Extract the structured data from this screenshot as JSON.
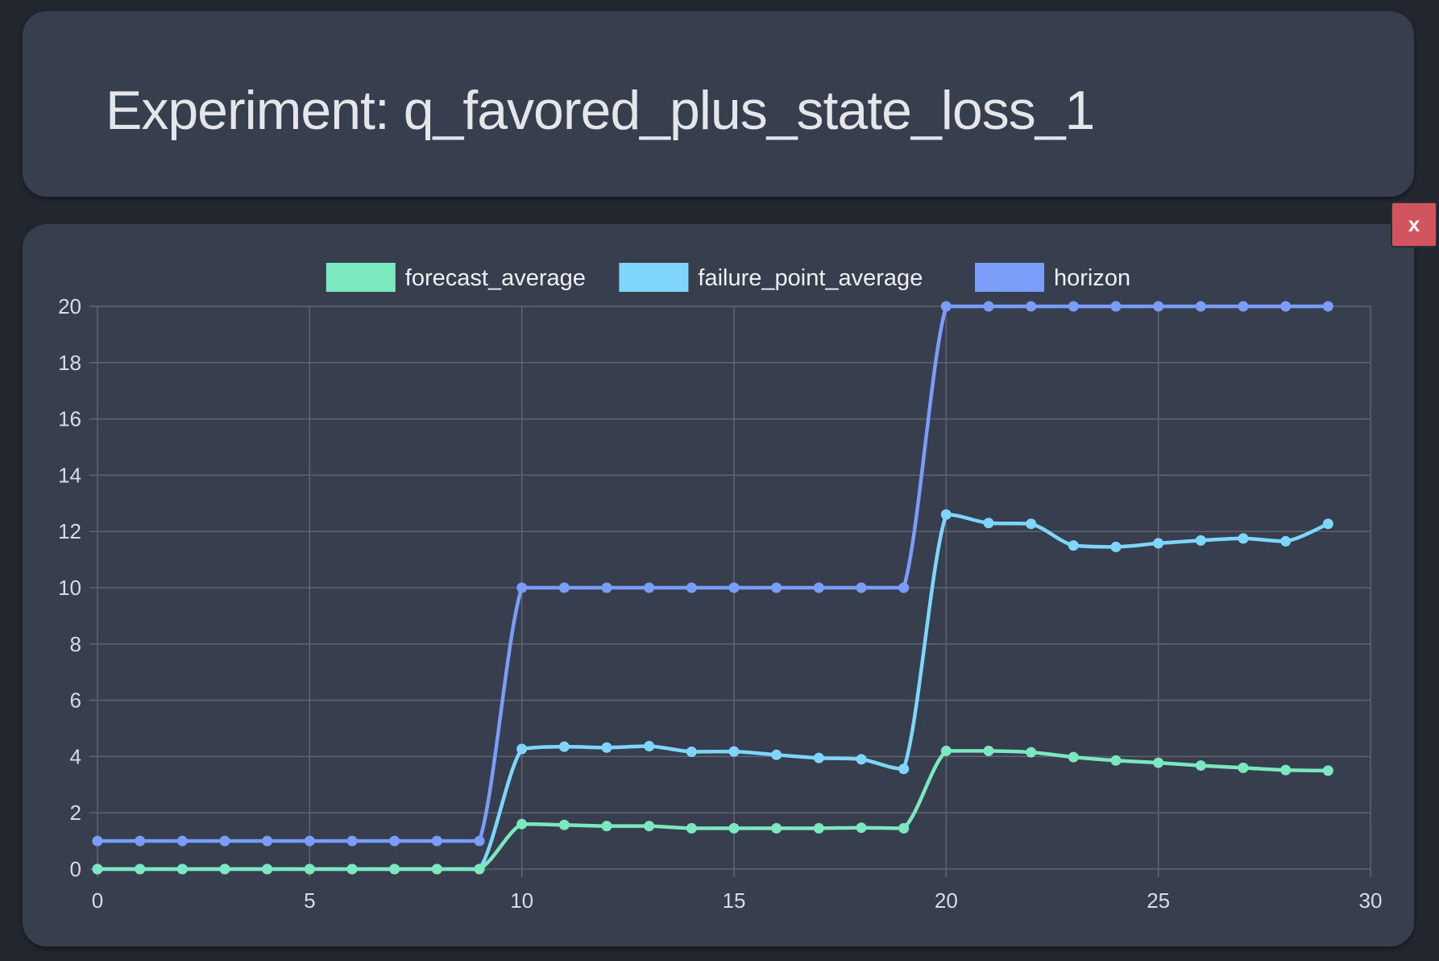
{
  "header": {
    "title": "Experiment: q_favored_plus_state_loss_1"
  },
  "close_button": {
    "label": "x"
  },
  "chart_data": {
    "type": "line",
    "legend_position": "top",
    "grid": true,
    "xlim": [
      0,
      30
    ],
    "ylim": [
      0,
      20
    ],
    "x_ticks": [
      0,
      5,
      10,
      15,
      20,
      25,
      30
    ],
    "y_ticks": [
      0,
      2,
      4,
      6,
      8,
      10,
      12,
      14,
      16,
      18,
      20
    ],
    "x": [
      0,
      1,
      2,
      3,
      4,
      5,
      6,
      7,
      8,
      9,
      10,
      11,
      12,
      13,
      14,
      15,
      16,
      17,
      18,
      19,
      20,
      21,
      22,
      23,
      24,
      25,
      26,
      27,
      28,
      29
    ],
    "series": [
      {
        "name": "forecast_average",
        "color": "#7ce8c0",
        "values": [
          0,
          0,
          0,
          0,
          0,
          0,
          0,
          0,
          0,
          0,
          1.6,
          1.57,
          1.53,
          1.53,
          1.45,
          1.45,
          1.45,
          1.45,
          1.47,
          1.45,
          4.2,
          4.2,
          4.15,
          3.98,
          3.86,
          3.78,
          3.68,
          3.6,
          3.52,
          3.5
        ]
      },
      {
        "name": "failure_point_average",
        "color": "#7fd6fd",
        "values": [
          0,
          0,
          0,
          0,
          0,
          0,
          0,
          0,
          0,
          0,
          4.27,
          4.35,
          4.32,
          4.37,
          4.17,
          4.18,
          4.06,
          3.95,
          3.9,
          3.56,
          12.6,
          12.3,
          12.27,
          11.5,
          11.45,
          11.58,
          11.68,
          11.75,
          11.65,
          12.27
        ]
      },
      {
        "name": "horizon",
        "color": "#7b9dfa",
        "values": [
          1,
          1,
          1,
          1,
          1,
          1,
          1,
          1,
          1,
          1,
          10,
          10,
          10,
          10,
          10,
          10,
          10,
          10,
          10,
          10,
          20,
          20,
          20,
          20,
          20,
          20,
          20,
          20,
          20,
          20
        ]
      }
    ]
  }
}
